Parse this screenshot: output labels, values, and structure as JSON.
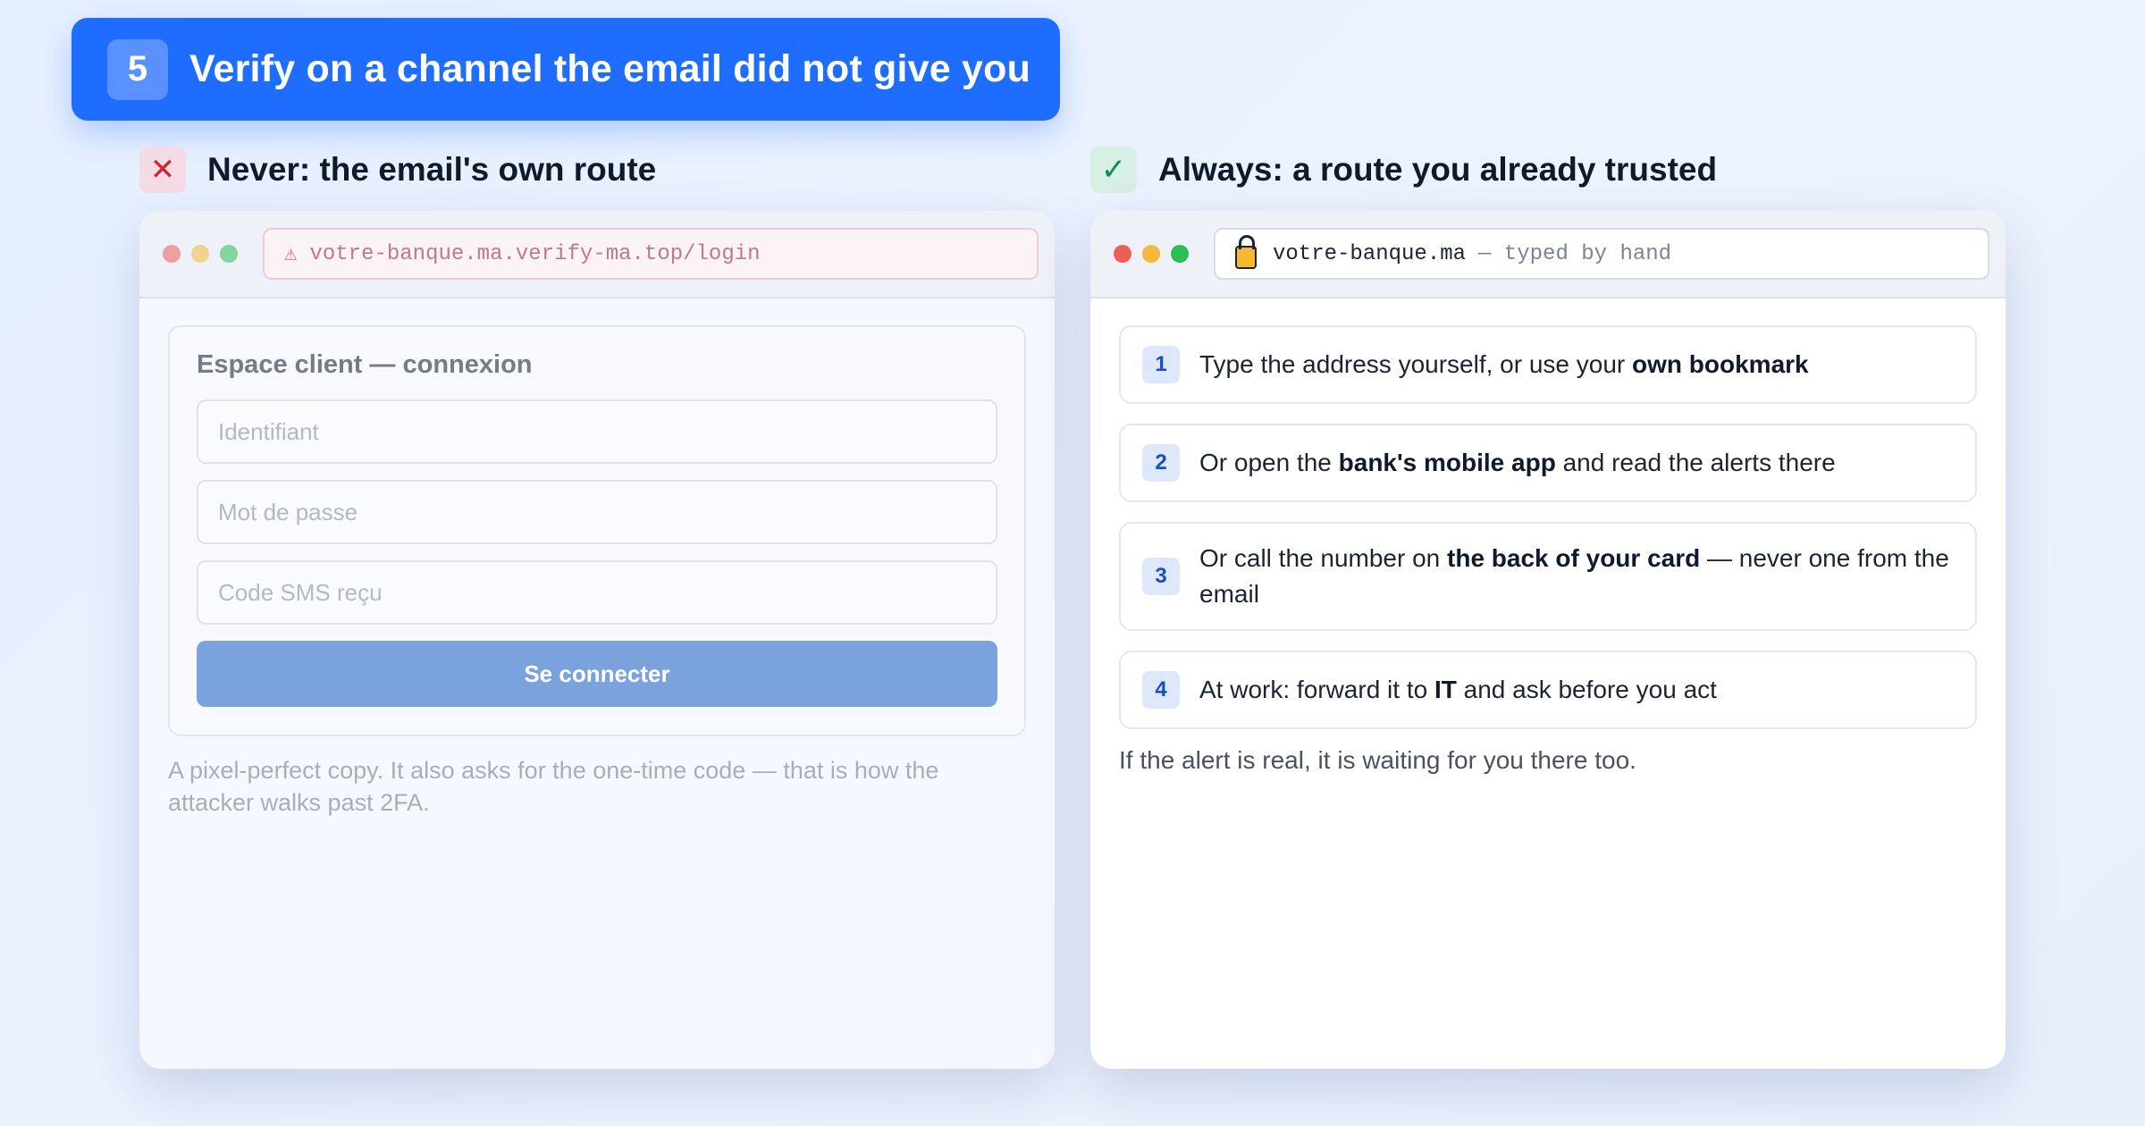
{
  "step": {
    "number": "5",
    "title": "Verify on a channel the email did not give you"
  },
  "never": {
    "mark": "✕",
    "heading": "Never: the email's own route",
    "address_bar": {
      "warning_icon": "⚠",
      "url": "votre-banque.ma.verify-ma.top/login"
    },
    "login_form": {
      "title": "Espace client — connexion",
      "fields": [
        {
          "placeholder": "Identifiant"
        },
        {
          "placeholder": "Mot de passe"
        },
        {
          "placeholder": "Code SMS reçu"
        }
      ],
      "submit_label": "Se connecter"
    },
    "note": "A pixel-perfect copy. It also asks for the one-time code — that is how the attacker walks past 2FA."
  },
  "always": {
    "mark": "✓",
    "heading": "Always: a route you already trusted",
    "address_bar": {
      "lock_icon": "lock-icon",
      "url": "votre-banque.ma",
      "suffix": "— typed by hand"
    },
    "steps": [
      {
        "number": "1",
        "text_before": "Type the address yourself, or use your ",
        "bold": "own bookmark",
        "text_after": ""
      },
      {
        "number": "2",
        "text_before": "Or open the ",
        "bold": "bank's mobile app",
        "text_after": " and read the alerts there"
      },
      {
        "number": "3",
        "text_before": "Or call the number on ",
        "bold": "the back of your card",
        "text_after": " — never one from the email"
      },
      {
        "number": "4",
        "text_before": "At work: forward it to ",
        "bold": "IT",
        "text_after": " and ask before you act"
      }
    ],
    "note": "If the alert is real, it is waiting for you there too."
  },
  "colors": {
    "accent": "#1f6dff",
    "bad": "#c9272f",
    "good": "#128a55",
    "muted_button": "#7aa2dd"
  }
}
